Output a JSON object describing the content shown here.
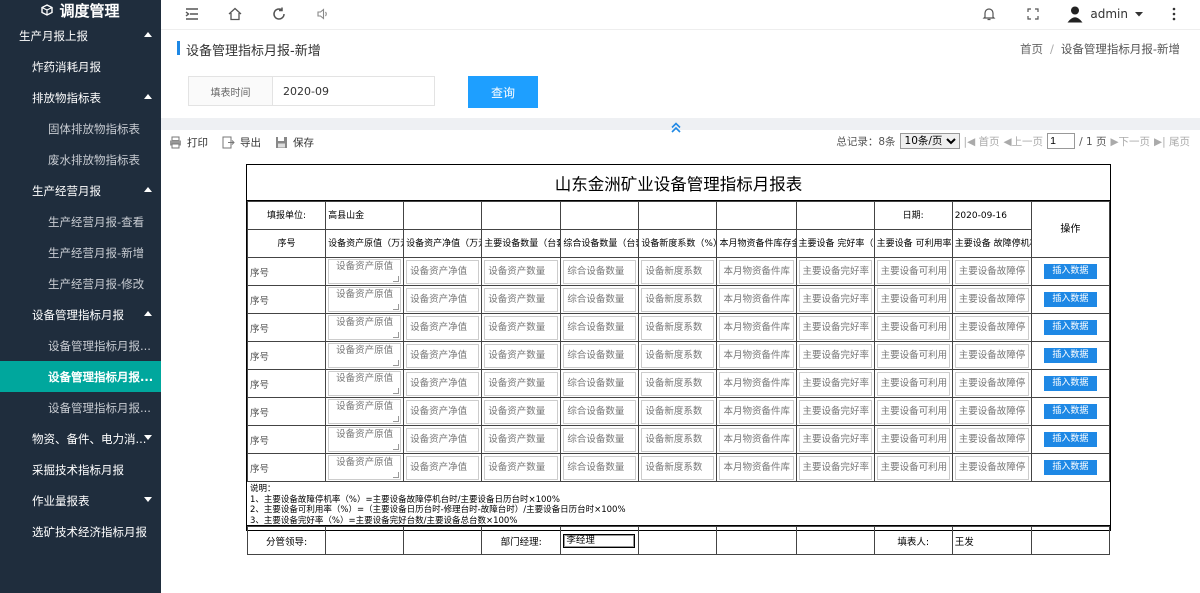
{
  "app": {
    "title": "调度管理"
  },
  "sidebar": {
    "items": [
      {
        "label": "生产月报上报",
        "kind": "top",
        "arrow": "up"
      },
      {
        "label": "炸药消耗月报",
        "kind": "lvl1"
      },
      {
        "label": "排放物指标表",
        "kind": "lvl1",
        "arrow": "up"
      },
      {
        "label": "固体排放物指标表",
        "kind": "sub"
      },
      {
        "label": "废水排放物指标表",
        "kind": "sub"
      },
      {
        "label": "生产经营月报",
        "kind": "lvl1",
        "arrow": "up"
      },
      {
        "label": "生产经营月报-查看",
        "kind": "sub"
      },
      {
        "label": "生产经营月报-新增",
        "kind": "sub"
      },
      {
        "label": "生产经营月报-修改",
        "kind": "sub"
      },
      {
        "label": "设备管理指标月报",
        "kind": "lvl1",
        "arrow": "up"
      },
      {
        "label": "设备管理指标月报...",
        "kind": "sub"
      },
      {
        "label": "设备管理指标月报...",
        "kind": "sub",
        "active": true
      },
      {
        "label": "设备管理指标月报...",
        "kind": "sub"
      },
      {
        "label": "物资、备件、电力消...",
        "kind": "lvl1",
        "arrow": "down"
      },
      {
        "label": "采掘技术指标月报",
        "kind": "lvl1"
      },
      {
        "label": "作业量报表",
        "kind": "lvl1",
        "arrow": "down"
      },
      {
        "label": "选矿技术经济指标月报",
        "kind": "lvl1"
      }
    ]
  },
  "topbar": {
    "user": "admin"
  },
  "page": {
    "title": "设备管理指标月报-新增",
    "breadcrumb": [
      "首页",
      "设备管理指标月报-新增"
    ]
  },
  "filter": {
    "label": "填表时间",
    "value": "2020-09",
    "query_label": "查询"
  },
  "toolbar": {
    "print": "打印",
    "export": "导出",
    "save": "保存"
  },
  "pager": {
    "total_label": "总记录：8条",
    "page_size": "10条/页",
    "first": "首页",
    "prev": "上一页",
    "page": "1",
    "of": "/ 1 页",
    "next": "下一页",
    "last": "尾页"
  },
  "sheet": {
    "title": "山东金洲矿业设备管理指标月报表",
    "unit_label": "填报单位:",
    "unit_value": "高县山金",
    "date_label": "日期:",
    "date_value": "2020-09-16",
    "op_label": "操作",
    "headers": [
      "序号",
      "设备资产原值（万元）",
      "设备资产净值（万元）",
      "主要设备数量（台套）",
      "综合设备数量（台套）",
      "设备新度系数（%）",
      "本月物资备件库存金额（万元）",
      "主要设备 完好率（%）",
      "主要设备 可利用率（%）",
      "主要设备 故障停机率（%）"
    ],
    "row_index": "序号",
    "placeholders": [
      "设备资产原值",
      "设备资产净值",
      "设备资产数量",
      "综合设备数量",
      "设备新度系数",
      "本月物资备件库",
      "主要设备完好率",
      "主要设备可利用",
      "主要设备故障停"
    ],
    "insert_label": "插入数据",
    "row_count": 8,
    "notes": [
      "说明：",
      "1、主要设备故障停机率（%）=主要设备故障停机台时/主要设备日历台时×100%",
      "2、主要设备可利用率（%）=（主要设备日历台时-修理台时-故障台时）/主要设备日历台时×100%",
      "3、主要设备完好率（%）=主要设备完好台数/主要设备总台数×100%"
    ],
    "leader_label": "分管领导:",
    "manager_label": "部门经理:",
    "manager_value": "李经理",
    "filler_label": "填表人:",
    "filler_value": "王发"
  }
}
